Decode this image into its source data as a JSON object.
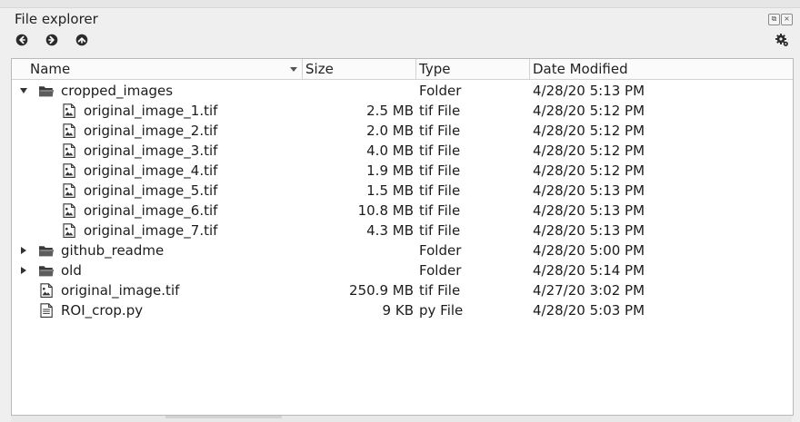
{
  "window": {
    "title": "File explorer"
  },
  "columns": {
    "name": "Name",
    "size": "Size",
    "type": "Type",
    "date": "Date Modified"
  },
  "rows": [
    {
      "name": "cropped_images",
      "size": "",
      "type": "Folder",
      "date": "4/28/20 5:13 PM",
      "kind": "folder",
      "depth": 0,
      "expander": "open"
    },
    {
      "name": "original_image_1.tif",
      "size": "2.5 MB",
      "type": "tif File",
      "date": "4/28/20 5:12 PM",
      "kind": "image",
      "depth": 1,
      "expander": "none"
    },
    {
      "name": "original_image_2.tif",
      "size": "2.0 MB",
      "type": "tif File",
      "date": "4/28/20 5:12 PM",
      "kind": "image",
      "depth": 1,
      "expander": "none"
    },
    {
      "name": "original_image_3.tif",
      "size": "4.0 MB",
      "type": "tif File",
      "date": "4/28/20 5:12 PM",
      "kind": "image",
      "depth": 1,
      "expander": "none"
    },
    {
      "name": "original_image_4.tif",
      "size": "1.9 MB",
      "type": "tif File",
      "date": "4/28/20 5:12 PM",
      "kind": "image",
      "depth": 1,
      "expander": "none"
    },
    {
      "name": "original_image_5.tif",
      "size": "1.5 MB",
      "type": "tif File",
      "date": "4/28/20 5:13 PM",
      "kind": "image",
      "depth": 1,
      "expander": "none"
    },
    {
      "name": "original_image_6.tif",
      "size": "10.8 MB",
      "type": "tif File",
      "date": "4/28/20 5:13 PM",
      "kind": "image",
      "depth": 1,
      "expander": "none"
    },
    {
      "name": "original_image_7.tif",
      "size": "4.3 MB",
      "type": "tif File",
      "date": "4/28/20 5:13 PM",
      "kind": "image",
      "depth": 1,
      "expander": "none"
    },
    {
      "name": "github_readme",
      "size": "",
      "type": "Folder",
      "date": "4/28/20 5:00 PM",
      "kind": "folder",
      "depth": 0,
      "expander": "closed"
    },
    {
      "name": "old",
      "size": "",
      "type": "Folder",
      "date": "4/28/20 5:14 PM",
      "kind": "folder",
      "depth": 0,
      "expander": "closed"
    },
    {
      "name": "original_image.tif",
      "size": "250.9 MB",
      "type": "tif File",
      "date": "4/27/20 3:02 PM",
      "kind": "image",
      "depth": 0,
      "expander": "none"
    },
    {
      "name": "ROI_crop.py",
      "size": "9 KB",
      "type": "py File",
      "date": "4/28/20 5:03 PM",
      "kind": "text",
      "depth": 0,
      "expander": "none"
    }
  ],
  "icons": {
    "back": "arrow-left-circle-icon",
    "forward": "arrow-right-circle-icon",
    "up": "arrow-up-circle-icon",
    "settings": "gear-icon",
    "folder": "folder-icon",
    "image": "image-file-icon",
    "text": "text-file-icon"
  }
}
